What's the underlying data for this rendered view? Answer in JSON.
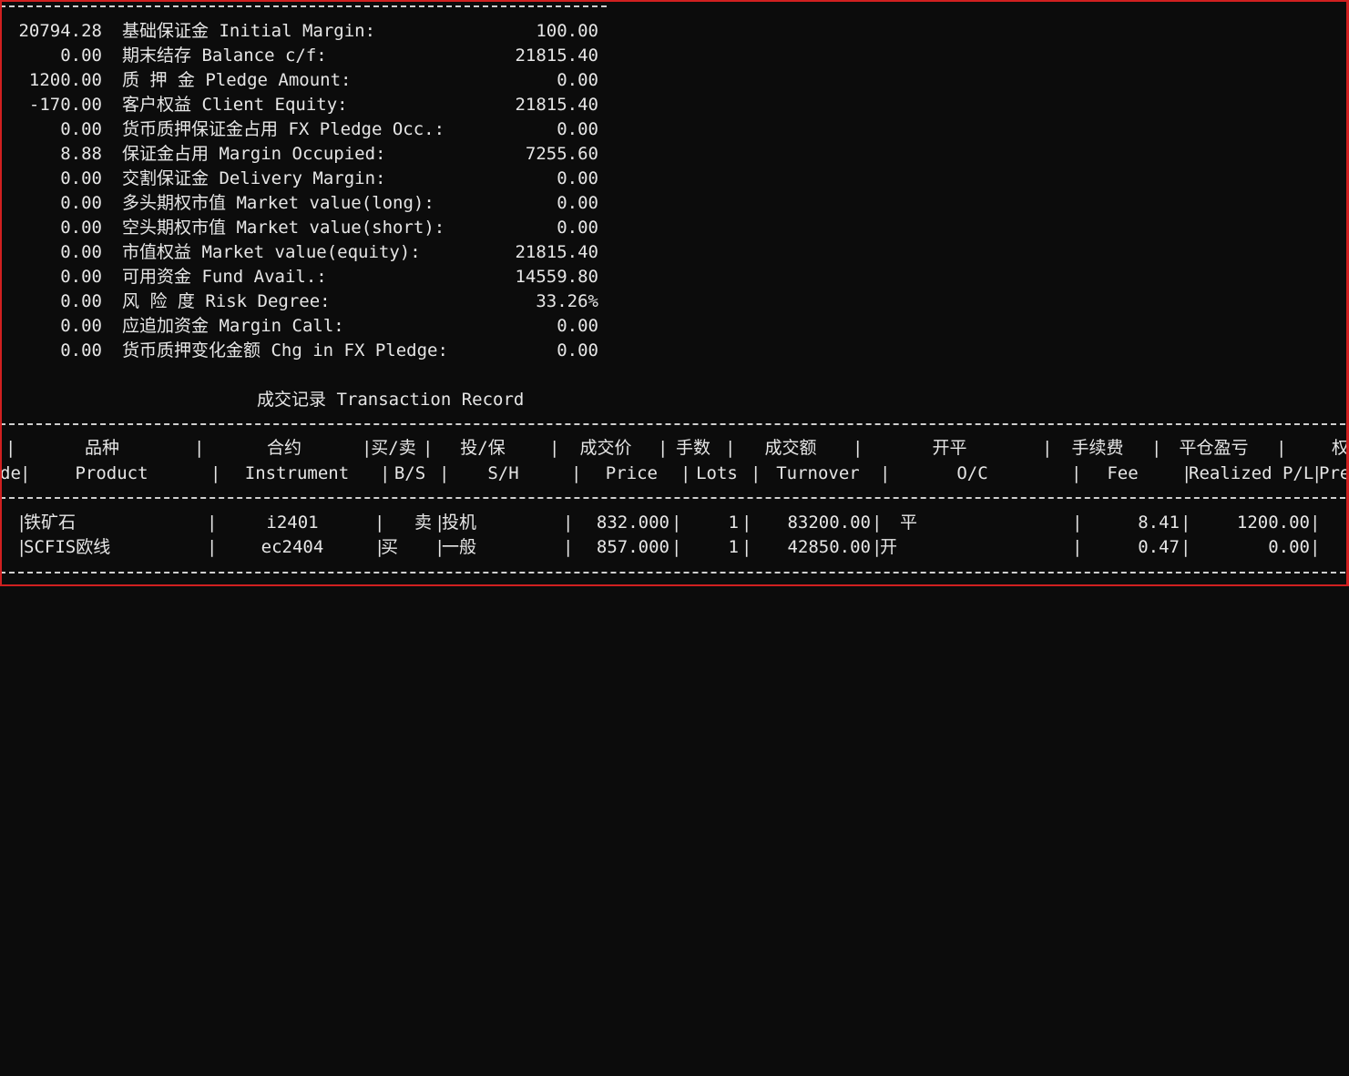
{
  "account_summary": [
    {
      "left_value": "20794.28",
      "label": "基础保证金 Initial Margin:",
      "right_value": "100.00"
    },
    {
      "left_value": "0.00",
      "label": "期末结存 Balance c/f:",
      "right_value": "21815.40"
    },
    {
      "left_value": "1200.00",
      "label": "质 押 金 Pledge Amount:",
      "right_value": "0.00"
    },
    {
      "left_value": "-170.00",
      "label": "客户权益 Client Equity:",
      "right_value": "21815.40"
    },
    {
      "left_value": "0.00",
      "label": "货币质押保证金占用 FX Pledge Occ.:",
      "right_value": "0.00"
    },
    {
      "left_value": "8.88",
      "label": "保证金占用 Margin Occupied:",
      "right_value": "7255.60"
    },
    {
      "left_value": "0.00",
      "label": "交割保证金 Delivery Margin:",
      "right_value": "0.00"
    },
    {
      "left_value": "0.00",
      "label": "多头期权市值 Market value(long):",
      "right_value": "0.00"
    },
    {
      "left_value": "0.00",
      "label": "空头期权市值 Market value(short):",
      "right_value": "0.00"
    },
    {
      "left_value": "0.00",
      "label": "市值权益 Market value(equity):",
      "right_value": "21815.40"
    },
    {
      "left_value": "0.00",
      "label": "可用资金 Fund Avail.:",
      "right_value": "14559.80"
    },
    {
      "left_value": "0.00",
      "label": "风 险 度 Risk Degree:",
      "right_value": "33.26%"
    },
    {
      "left_value": "0.00",
      "label": "应追加资金 Margin Call:",
      "right_value": "0.00"
    },
    {
      "left_value": "0.00",
      "label": "货币质押变化金额 Chg in FX Pledge:",
      "right_value": "0.00"
    }
  ],
  "transaction_section": {
    "title": "成交记录 Transaction Record",
    "columns_cn": [
      "品种",
      "合约",
      "买/卖",
      "投/保",
      "成交价",
      "手数",
      "成交额",
      "开平",
      "手续费",
      "平仓盈亏",
      "权"
    ],
    "columns_en": [
      "de",
      "Product",
      "Instrument",
      "B/S",
      "S/H",
      "Price",
      "Lots",
      "Turnover",
      "O/C",
      "Fee",
      "Realized P/L",
      "Pre"
    ],
    "rows": [
      {
        "product": "铁矿石",
        "instrument": "i2401",
        "bs": "卖",
        "sh": "投机",
        "price": "832.000",
        "lots": "1",
        "turnover": "83200.00",
        "oc": "平",
        "fee": "8.41",
        "realized": "1200.00"
      },
      {
        "product": "SCFIS欧线",
        "instrument": "ec2404",
        "bs": "买",
        "sh": "一般",
        "price": "857.000",
        "lots": "1",
        "turnover": "42850.00",
        "oc": "开",
        "fee": "0.47",
        "realized": "0.00"
      }
    ]
  }
}
